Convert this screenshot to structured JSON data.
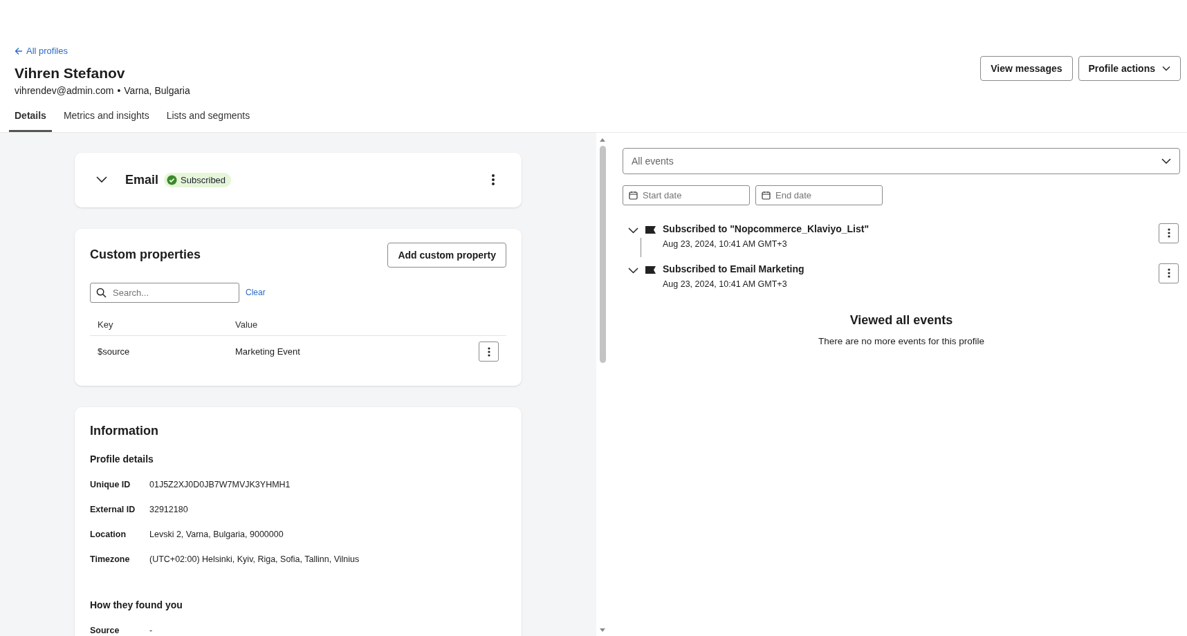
{
  "back_link": "All profiles",
  "profile": {
    "name": "Vihren Stefanov",
    "email": "vihrendev@admin.com",
    "separator": "•",
    "location": "Varna, Bulgaria"
  },
  "header_buttons": [
    {
      "label": "View messages",
      "kind": "plain"
    },
    {
      "label": "Profile actions",
      "kind": "dropdown"
    }
  ],
  "tabs": [
    {
      "label": "Details",
      "selected": true
    },
    {
      "label": "Metrics and insights",
      "selected": false
    },
    {
      "label": "Lists and segments",
      "selected": false
    }
  ],
  "email_card": {
    "title": "Email",
    "status": "Subscribed",
    "subscribed": true,
    "expanded": false
  },
  "custom_properties": {
    "title": "Custom properties",
    "add_button": "Add custom property",
    "search": {
      "placeholder": "Search..."
    },
    "clear": "Clear",
    "columns": [
      "Key",
      "Value"
    ],
    "rows": [
      {
        "key": "$source",
        "value": "Marketing Event"
      }
    ]
  },
  "information": {
    "title": "Information",
    "sections": [
      {
        "title": "Profile details",
        "fields": [
          {
            "label": "Unique ID",
            "value": "01J5Z2XJ0D0JB7W7MVJK3YHMH1"
          },
          {
            "label": "External ID",
            "value": "32912180"
          },
          {
            "label": "Location",
            "value": "Levski 2, Varna, Bulgaria, 9000000"
          },
          {
            "label": "Timezone",
            "value": "(UTC+02:00) Helsinki, Kyiv, Riga, Sofia, Tallinn, Vilnius"
          }
        ]
      },
      {
        "title": "How they found you",
        "fields": [
          {
            "label": "Source",
            "value": "-"
          }
        ]
      }
    ]
  },
  "events": {
    "filter": {
      "value": "All events"
    },
    "start_date": {
      "placeholder": "Start date"
    },
    "end_date": {
      "placeholder": "End date"
    },
    "items": [
      {
        "title": "Subscribed to \"Nopcommerce_Klaviyo_List\"",
        "time": "Aug 23, 2024, 10:41 AM GMT+3",
        "expanded": false
      },
      {
        "title": "Subscribed to Email Marketing",
        "time": "Aug 23, 2024, 10:41 AM GMT+3",
        "expanded": false
      }
    ],
    "end_title": "Viewed all events",
    "end_text": "There are no more events for this profile"
  }
}
